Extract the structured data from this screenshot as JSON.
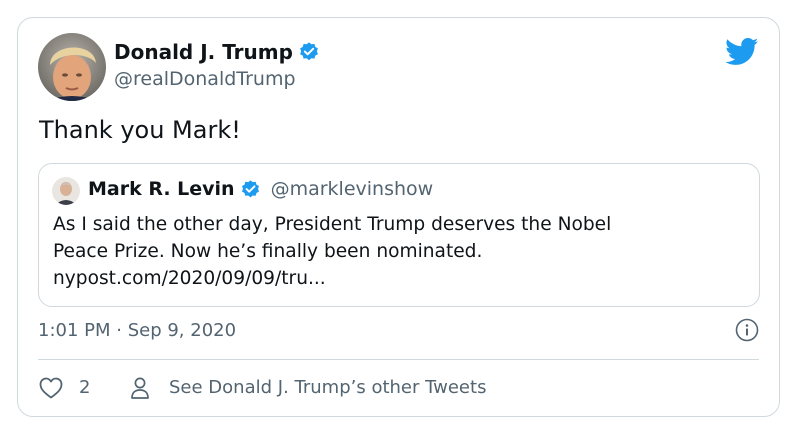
{
  "tweet": {
    "author_name": "Donald J. Trump",
    "author_handle": "@realDonaldTrump",
    "text": "Thank you Mark!",
    "timestamp": "1:01 PM · Sep 9, 2020",
    "like_count": "2",
    "other_tweets_label": "See Donald J. Trump’s other Tweets"
  },
  "quote": {
    "author_name": "Mark R. Levin",
    "author_handle": "@marklevinshow",
    "lines": [
      "As I said the other day, President Trump deserves the Nobel",
      "Peace Prize. Now he’s finally been nominated.",
      "nypost.com/2020/09/09/tru..."
    ]
  },
  "colors": {
    "brand": "#1d9bf0",
    "text": "#0f1419",
    "secondary": "#536471",
    "border": "#cfd9de"
  },
  "icons": {
    "brand": "twitter-bird-icon",
    "verified": "verified-badge-icon",
    "info": "info-icon",
    "like": "heart-icon",
    "profile": "person-icon"
  }
}
